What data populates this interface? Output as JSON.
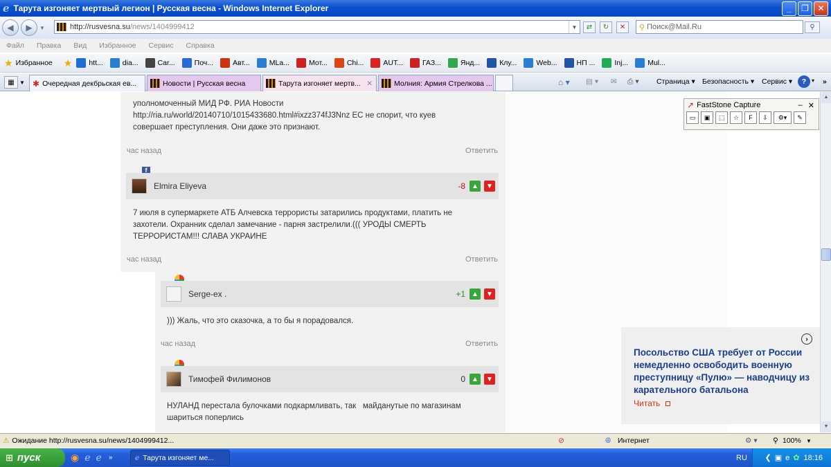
{
  "window": {
    "title": "Тарута изгоняет мертвый легион | Русская весна - Windows Internet Explorer"
  },
  "address": {
    "url_host": "http://rusvesna.su",
    "url_path": "/news/1404999412",
    "search_placeholder": "Поиск@Mail.Ru"
  },
  "menu": [
    "Файл",
    "Правка",
    "Вид",
    "Избранное",
    "Сервис",
    "Справка"
  ],
  "favorites": {
    "label": "Избранное",
    "items": [
      {
        "label": "htt...",
        "color": "#1e6ed6"
      },
      {
        "label": "dia...",
        "color": "#2a7fd4"
      },
      {
        "label": "Car...",
        "color": "#444444"
      },
      {
        "label": "Поч...",
        "color": "#2a6ad8"
      },
      {
        "label": "Авт...",
        "color": "#cc3311"
      },
      {
        "label": "MLa...",
        "color": "#2a7fd4"
      },
      {
        "label": "Мот...",
        "color": "#cc2222"
      },
      {
        "label": "Chi...",
        "color": "#dd4411"
      },
      {
        "label": "AUT...",
        "color": "#dd2222"
      },
      {
        "label": "ГАЗ...",
        "color": "#cc2222"
      },
      {
        "label": "Янд...",
        "color": "#2fa84f"
      },
      {
        "label": "Клу...",
        "color": "#2255aa"
      },
      {
        "label": "Web...",
        "color": "#2a7fd4"
      },
      {
        "label": "НП ...",
        "color": "#2255aa"
      },
      {
        "label": "Inj...",
        "color": "#22aa55"
      },
      {
        "label": "Mul...",
        "color": "#2a7fd4"
      }
    ]
  },
  "tabs": [
    {
      "label": "Очередная декбрьская ев...",
      "bg": "#f0f4fa"
    },
    {
      "label": "Новости | Русская весна",
      "bg": "#e4c8f0"
    },
    {
      "label": "Тарута изгоняет мертв...",
      "bg": "#f7e3ef"
    },
    {
      "label": "Молния: Армия Стрелкова ...",
      "bg": "#e4c8f0"
    }
  ],
  "commandbar": {
    "page": "Страница",
    "safety": "Безопасность",
    "tools": "Сервис"
  },
  "comments": [
    {
      "text_lines": [
        "уполномоченный МИД РФ. РИА Новости",
        "http://ria.ru/world/20140710/1015433680.html#ixzz374fJ3Nnz ЕС не спорит, что куев",
        "совершает преступления. Они даже это признают."
      ],
      "time": "час назад",
      "reply": "Ответить"
    },
    {
      "author": "Elmira Eliyeva",
      "score": "-8",
      "text_lines": [
        "7 июля в супермаркете АТБ Алчевска террористы затарились продуктами, платить не",
        "захотели. Охранник сделал замечание - парня застрелили.((( УРОДЫ СМЕРТЬ",
        "ТЕРРОРИСТАМ!!! СЛАВА УКРАИНЕ"
      ],
      "time": "час назад",
      "reply": "Ответить"
    },
    {
      "author": "Serge-ex .",
      "score": "+1",
      "text_lines": [
        "))) Жаль, что это сказочка, а то бы я порадовался."
      ],
      "time": "час назад",
      "reply": "Ответить"
    },
    {
      "author": "Тимофей Филимонов",
      "score": "0",
      "text_lines": [
        "НУЛАНД перестала булочками подкармливать, так   майданутые по магазинам",
        "шариться поперлись"
      ]
    }
  ],
  "faststone": {
    "title": "FastStone Capture"
  },
  "ad": {
    "text": "Посольство США требует от России немедленно освободить военную преступницу «Пулю» — наводчицу из карательного батальона",
    "link": "Читать"
  },
  "status": {
    "text": "Ожидание http://rusvesna.su/news/1404999412...",
    "zone": "Интернет",
    "zoom": "100%"
  },
  "taskbar": {
    "start": "пуск",
    "task": "Тарута изгоняет ме...",
    "lang": "RU",
    "time": "18:16"
  },
  "colors": {
    "score_pos": "#2a8a2a",
    "score_neg": "#cc1111",
    "ad_title": "#1a3f8a",
    "ad_link": "#dd3311"
  }
}
